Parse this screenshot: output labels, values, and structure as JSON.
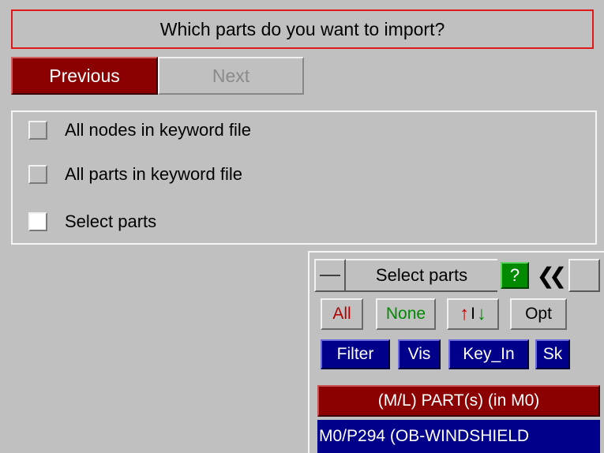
{
  "prompt": {
    "question": "Which parts do you want to import?"
  },
  "nav": {
    "previous_label": "Previous",
    "next_label": "Next"
  },
  "options": [
    {
      "label": "All nodes in keyword file",
      "checked": false
    },
    {
      "label": "All parts in keyword file",
      "checked": false
    },
    {
      "label": "Select parts",
      "checked": false
    }
  ],
  "panel": {
    "title": "Select parts",
    "help_label": "?",
    "collapse_glyph": "❮❮",
    "buttons": {
      "all_label": "All",
      "none_label": "None",
      "swap_up": "↑",
      "swap_bar": "I",
      "swap_down": "↓",
      "opt_label": "Opt",
      "filter_label": "Filter",
      "vis_label": "Vis",
      "key_in_label": "Key_In",
      "sk_label": "Sk"
    },
    "list_header": "(M/L) PART(s) (in M0)",
    "list_items": [
      "M0/P294 (OB-WINDSHIELD"
    ]
  },
  "colors": {
    "background": "#c0c0c0",
    "accent_red": "#8b0000",
    "accent_blue": "#00008b",
    "help_green": "#008a00",
    "prompt_border": "#e01818"
  }
}
